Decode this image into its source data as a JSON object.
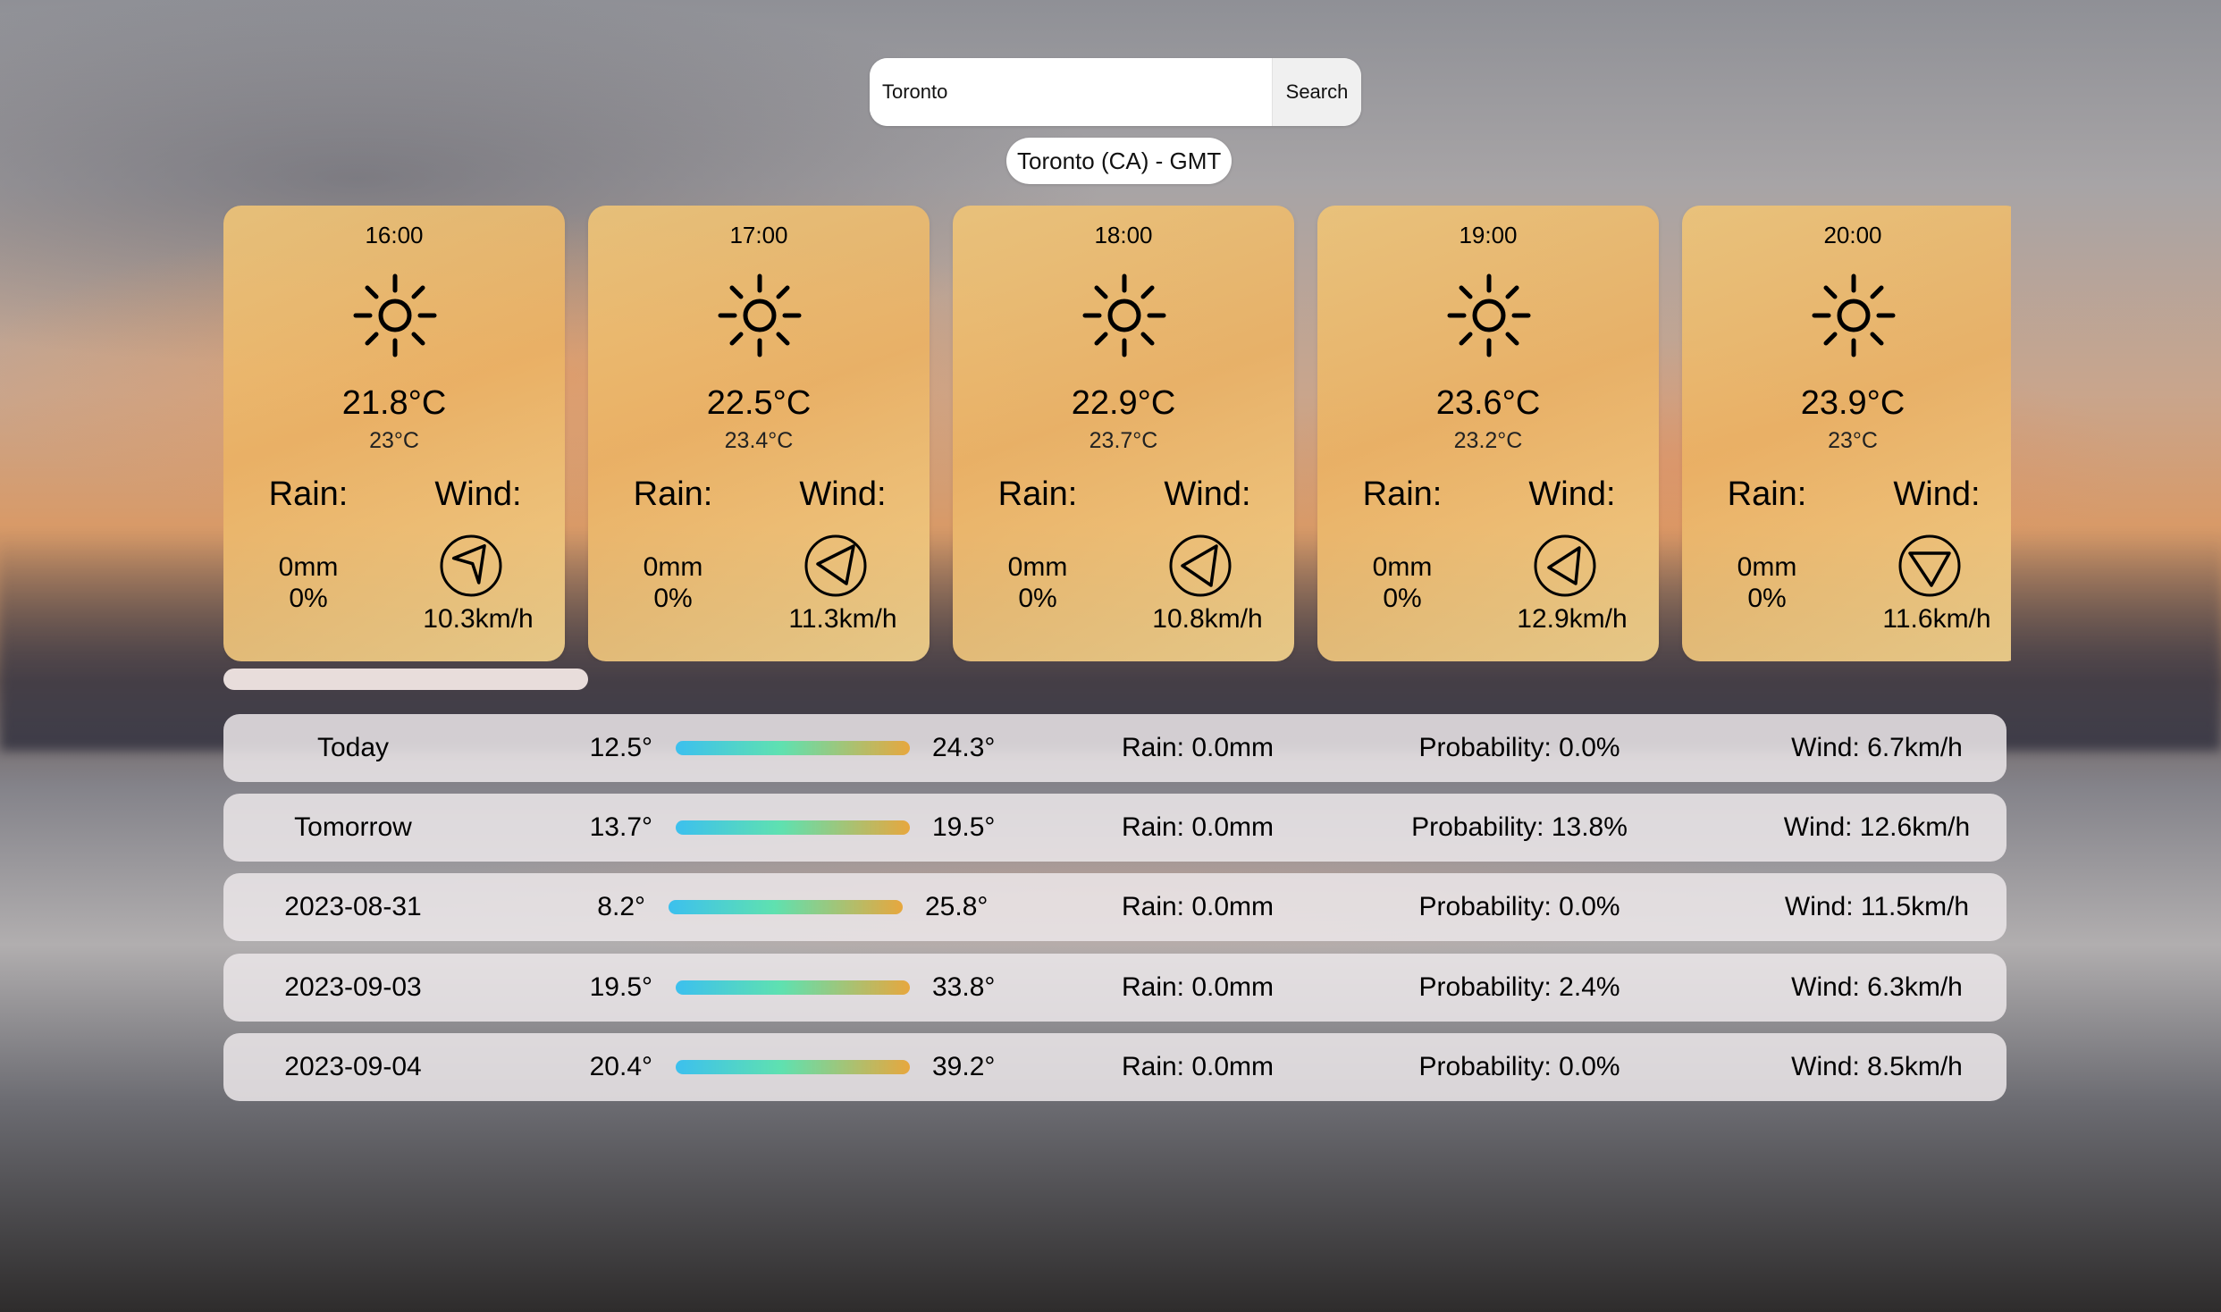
{
  "search": {
    "value": "Toronto",
    "button_label": "Search"
  },
  "location": "Toronto (CA) - GMT",
  "hourly": [
    {
      "time": "16:00",
      "icon": "sun-icon",
      "temp": "21.8°C",
      "feels": "23°C",
      "rain_label": "Rain:",
      "wind_label": "Wind:",
      "rain_mm": "0mm",
      "rain_pct": "0%",
      "wind_speed": "10.3km/h",
      "wind_icon": "wind-direction-icon"
    },
    {
      "time": "17:00",
      "icon": "sun-icon",
      "temp": "22.5°C",
      "feels": "23.4°C",
      "rain_label": "Rain:",
      "wind_label": "Wind:",
      "rain_mm": "0mm",
      "rain_pct": "0%",
      "wind_speed": "11.3km/h",
      "wind_icon": "wind-direction-icon"
    },
    {
      "time": "18:00",
      "icon": "sun-icon",
      "temp": "22.9°C",
      "feels": "23.7°C",
      "rain_label": "Rain:",
      "wind_label": "Wind:",
      "rain_mm": "0mm",
      "rain_pct": "0%",
      "wind_speed": "10.8km/h",
      "wind_icon": "wind-direction-icon"
    },
    {
      "time": "19:00",
      "icon": "sun-icon",
      "temp": "23.6°C",
      "feels": "23.2°C",
      "rain_label": "Rain:",
      "wind_label": "Wind:",
      "rain_mm": "0mm",
      "rain_pct": "0%",
      "wind_speed": "12.9km/h",
      "wind_icon": "wind-direction-icon"
    },
    {
      "time": "20:00",
      "icon": "sun-icon",
      "temp": "23.9°C",
      "feels": "23°C",
      "rain_label": "Rain:",
      "wind_label": "Wind:",
      "rain_mm": "0mm",
      "rain_pct": "0%",
      "wind_speed": "11.6km/h",
      "wind_icon": "wind-direction-icon"
    }
  ],
  "daily": [
    {
      "day": "Today",
      "min": "12.5°",
      "max": "24.3°",
      "rain": "Rain: 0.0mm",
      "probability": "Probability: 0.0%",
      "wind": "Wind: 6.7km/h"
    },
    {
      "day": "Tomorrow",
      "min": "13.7°",
      "max": "19.5°",
      "rain": "Rain: 0.0mm",
      "probability": "Probability: 13.8%",
      "wind": "Wind: 12.6km/h"
    },
    {
      "day": "2023-08-31",
      "min": "8.2°",
      "max": "25.8°",
      "rain": "Rain: 0.0mm",
      "probability": "Probability: 0.0%",
      "wind": "Wind: 11.5km/h"
    },
    {
      "day": "2023-09-03",
      "min": "19.5°",
      "max": "33.8°",
      "rain": "Rain: 0.0mm",
      "probability": "Probability: 2.4%",
      "wind": "Wind: 6.3km/h"
    },
    {
      "day": "2023-09-04",
      "min": "20.4°",
      "max": "39.2°",
      "rain": "Rain: 0.0mm",
      "probability": "Probability: 0.0%",
      "wind": "Wind: 8.5km/h"
    }
  ],
  "colors": {
    "card": "#EBB264",
    "temp_bar_cold": "#3CC0EE",
    "temp_bar_mid": "#5FE1B0",
    "temp_bar_warm": "#E7A73E"
  }
}
